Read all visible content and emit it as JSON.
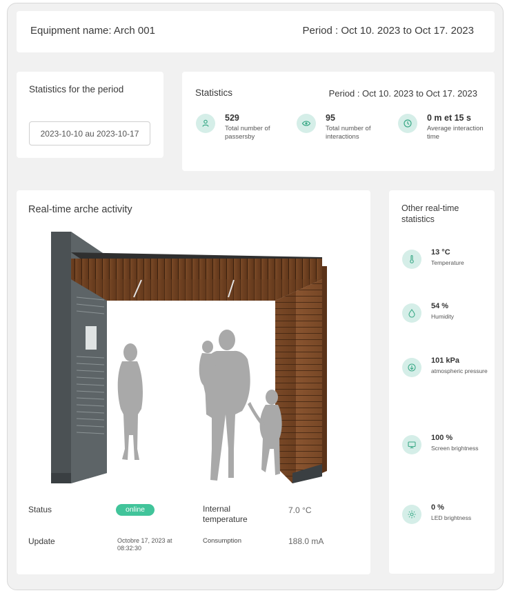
{
  "header": {
    "equipment_name": "Equipment name: Arch 001",
    "period": "Period : Oct 10. 2023 to Oct 17. 2023"
  },
  "stats_period": {
    "title": "Statistics for the period",
    "date_range_value": "2023-10-10 au 2023-10-17"
  },
  "statistics": {
    "title": "Statistics",
    "period": "Period : Oct 10. 2023 to Oct 17. 2023",
    "items": [
      {
        "value": "529",
        "label": "Total number of passersby",
        "icon": "person-icon"
      },
      {
        "value": "95",
        "label": "Total number of interactions",
        "icon": "eye-icon"
      },
      {
        "value": "0 m et 15 s",
        "label": "Average interaction time",
        "icon": "clock-icon"
      }
    ]
  },
  "activity": {
    "title": "Real-time arche activity",
    "status_label": "Status",
    "status_value": "online",
    "internal_temp_label": "Internal temperature",
    "internal_temp_value": "7.0 °C",
    "update_label": "Update",
    "update_value": "Octobre 17, 2023 at 08:32:30",
    "consumption_label": "Consumption",
    "consumption_value": "188.0 mA"
  },
  "other_stats": {
    "title": "Other real-time statistics",
    "items": [
      {
        "value": "13 °C",
        "label": "Temperature",
        "icon": "thermometer-icon"
      },
      {
        "value": "54 %",
        "label": "Humidity",
        "icon": "droplet-icon"
      },
      {
        "value": "101 kPa",
        "label": "atmospheric pressure",
        "icon": "pressure-icon"
      },
      {
        "value": "100 %",
        "label": "Screen brightness",
        "icon": "monitor-icon"
      },
      {
        "value": "0 %",
        "label": "LED brightness",
        "icon": "sun-icon"
      }
    ]
  },
  "colors": {
    "accent": "#41c49a",
    "icon_bg": "#d5eee8",
    "icon_fg": "#3aa987"
  }
}
